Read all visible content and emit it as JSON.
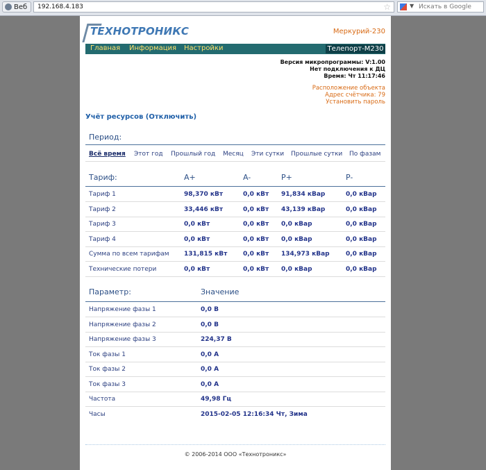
{
  "browser": {
    "web_button_label": "Веб",
    "url": "192.168.4.183",
    "search_placeholder": "Искать в Google"
  },
  "header": {
    "logo_text": "ТЕХНОТРОНИКС",
    "model": "Меркурий-230",
    "nav": [
      "Главная",
      "Информация",
      "Настройки"
    ],
    "device": "Телепорт-М230"
  },
  "info": {
    "firmware": "Версия микропрограммы: V:1.00",
    "connection": "Нет подключения к ДЦ",
    "time": "Время: Чт 11:17:46"
  },
  "links": {
    "location": "Расположение объекта",
    "address": "Адрес счётчика: 79",
    "password": "Установить пароль"
  },
  "resources": {
    "title": "Учёт ресурсов",
    "disable_link": "(Отключить)"
  },
  "period": {
    "label": "Период:",
    "options": [
      "Всё время",
      "Этот год",
      "Прошлый год",
      "Месяц",
      "Эти сутки",
      "Прошлые сутки",
      "По фазам"
    ],
    "active_index": 0
  },
  "tariffs": {
    "headers": [
      "Тариф:",
      "A+",
      "A-",
      "P+",
      "P-"
    ],
    "rows": [
      [
        "Тариф 1",
        "98,370 кВт",
        "0,0 кВт",
        "91,834 кВар",
        "0,0 кВар"
      ],
      [
        "Тариф 2",
        "33,446 кВт",
        "0,0 кВт",
        "43,139 кВар",
        "0,0 кВар"
      ],
      [
        "Тариф 3",
        "0,0 кВт",
        "0,0 кВт",
        "0,0 кВар",
        "0,0 кВар"
      ],
      [
        "Тариф 4",
        "0,0 кВт",
        "0,0 кВт",
        "0,0 кВар",
        "0,0 кВар"
      ],
      [
        "Сумма по всем тарифам",
        "131,815 кВт",
        "0,0 кВт",
        "134,973 кВар",
        "0,0 кВар"
      ],
      [
        "Технические потери",
        "0,0 кВт",
        "0,0 кВт",
        "0,0 кВар",
        "0,0 кВар"
      ]
    ]
  },
  "parameters": {
    "headers": [
      "Параметр:",
      "Значение"
    ],
    "rows": [
      [
        "Напряжение фазы 1",
        "0,0 В"
      ],
      [
        "Напряжение фазы 2",
        "0,0 В"
      ],
      [
        "Напряжение фазы 3",
        "224,37 В"
      ],
      [
        "Ток фазы 1",
        "0,0 А"
      ],
      [
        "Ток фазы 2",
        "0,0 А"
      ],
      [
        "Ток фазы 3",
        "0,0 А"
      ],
      [
        "Частота",
        "49,98 Гц"
      ],
      [
        "Часы",
        "2015-02-05 12:16:34 Чт, Зима"
      ]
    ]
  },
  "footer": "© 2006-2014 ООО «Технотроникс»"
}
